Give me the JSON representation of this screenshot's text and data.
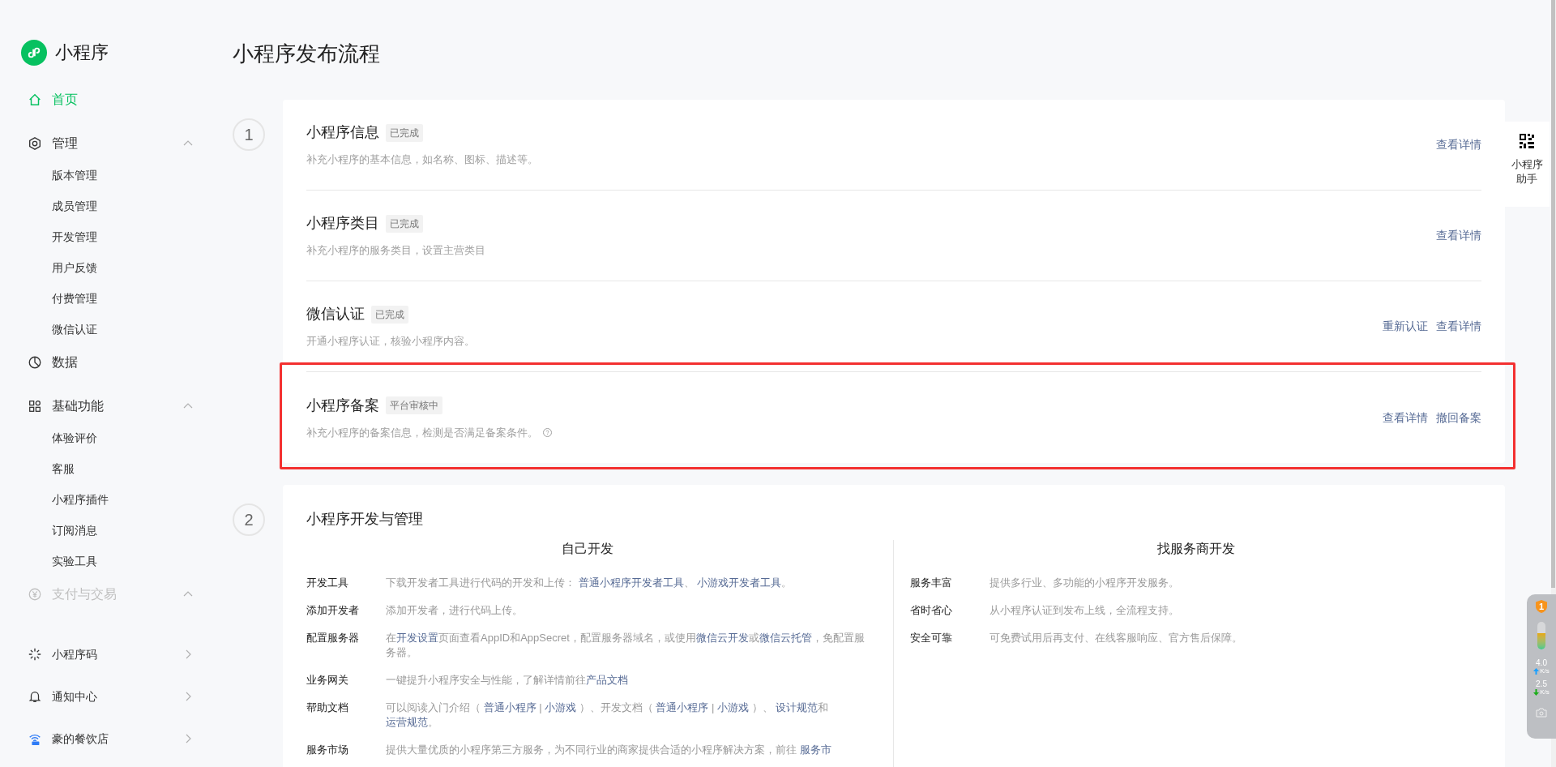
{
  "sidebar": {
    "logo": "小程序",
    "items": [
      {
        "kind": "link",
        "label": "首页",
        "selected": true
      },
      {
        "kind": "group",
        "label": "管理",
        "expanded": true,
        "disabled": false,
        "children": [
          {
            "label": "版本管理"
          },
          {
            "label": "成员管理"
          },
          {
            "label": "开发管理"
          },
          {
            "label": "用户反馈"
          },
          {
            "label": "付费管理"
          },
          {
            "label": "微信认证"
          }
        ]
      },
      {
        "kind": "link",
        "label": "数据",
        "selected": false
      },
      {
        "kind": "group",
        "label": "基础功能",
        "expanded": true,
        "disabled": false,
        "children": [
          {
            "label": "体验评价"
          },
          {
            "label": "客服"
          },
          {
            "label": "小程序插件"
          },
          {
            "label": "订阅消息"
          },
          {
            "label": "实验工具"
          }
        ]
      },
      {
        "kind": "group",
        "label": "支付与交易",
        "expanded": true,
        "disabled": true
      },
      {
        "kind": "nav",
        "label": "小程序码"
      },
      {
        "kind": "nav",
        "label": "通知中心"
      },
      {
        "kind": "nav",
        "label": "豪的餐饮店"
      }
    ]
  },
  "page_title": "小程序发布流程",
  "steps": [
    {
      "kind": "tasks",
      "number": "1",
      "items": [
        {
          "title": "小程序信息",
          "status": "已完成",
          "description": "补充小程序的基本信息，如名称、图标、描述等。",
          "help": false,
          "highlighted": false,
          "actions": [
            "查看详情"
          ]
        },
        {
          "title": "小程序类目",
          "status": "已完成",
          "description": "补充小程序的服务类目，设置主营类目",
          "help": false,
          "highlighted": false,
          "actions": [
            "查看详情"
          ]
        },
        {
          "title": "微信认证",
          "status": "已完成",
          "description": "开通小程序认证，核验小程序内容。",
          "help": false,
          "highlighted": false,
          "actions": [
            "重新认证",
            "查看详情"
          ]
        },
        {
          "title": "小程序备案",
          "status": "平台审核中",
          "description": "补充小程序的备案信息，检测是否满足备案条件。",
          "help": true,
          "highlighted": true,
          "actions": [
            "查看详情",
            "撤回备案"
          ]
        }
      ]
    },
    {
      "kind": "dev",
      "number": "2",
      "title": "小程序开发与管理",
      "columns": [
        {
          "heading": "自己开发",
          "rows": [
            {
              "label": "开发工具",
              "text": [
                {
                  "kind": "text",
                  "text": "下载开发者工具进行代码的开发和上传： "
                },
                {
                  "kind": "link",
                  "text": "普通小程序开发者工具"
                },
                {
                  "kind": "text",
                  "text": "、 "
                },
                {
                  "kind": "link",
                  "text": "小游戏开发者工具"
                },
                {
                  "kind": "text",
                  "text": "。"
                }
              ]
            },
            {
              "label": "添加开发者",
              "text": [
                {
                  "kind": "text",
                  "text": "添加开发者，进行代码上传。"
                }
              ]
            },
            {
              "label": "配置服务器",
              "text": [
                {
                  "kind": "text",
                  "text": "在"
                },
                {
                  "kind": "link",
                  "text": "开发设置"
                },
                {
                  "kind": "text",
                  "text": "页面查看AppID和AppSecret，配置服务器域名，或使用"
                },
                {
                  "kind": "link",
                  "text": "微信云开发"
                },
                {
                  "kind": "text",
                  "text": "或"
                },
                {
                  "kind": "link",
                  "text": "微信云托管"
                },
                {
                  "kind": "text",
                  "text": "，免配置服务器。"
                }
              ]
            },
            {
              "label": "业务网关",
              "text": [
                {
                  "kind": "text",
                  "text": "一键提升小程序安全与性能，了解详情前往"
                },
                {
                  "kind": "link",
                  "text": "产品文档"
                }
              ]
            },
            {
              "label": "帮助文档",
              "text": [
                {
                  "kind": "text",
                  "text": "可以阅读入门介绍（ "
                },
                {
                  "kind": "link",
                  "text": "普通小程序"
                },
                {
                  "kind": "text",
                  "text": " | "
                },
                {
                  "kind": "link",
                  "text": "小游戏"
                },
                {
                  "kind": "text",
                  "text": " ）、开发文档（ "
                },
                {
                  "kind": "link",
                  "text": "普通小程序"
                },
                {
                  "kind": "text",
                  "text": " | "
                },
                {
                  "kind": "link",
                  "text": "小游戏"
                },
                {
                  "kind": "text",
                  "text": " ）、 "
                },
                {
                  "kind": "link",
                  "text": "设计规范"
                },
                {
                  "kind": "text",
                  "text": "和"
                },
                {
                  "kind": "link",
                  "text": "运营规范"
                },
                {
                  "kind": "text",
                  "text": "。"
                }
              ]
            },
            {
              "label": "服务市场",
              "text": [
                {
                  "kind": "text",
                  "text": "提供大量优质的小程序第三方服务，为不同行业的商家提供合适的小程序解决方案，前往 "
                },
                {
                  "kind": "link",
                  "text": "服务市"
                }
              ]
            }
          ]
        },
        {
          "heading": "找服务商开发",
          "rows": [
            {
              "label": "服务丰富",
              "text": [
                {
                  "kind": "text",
                  "text": "提供多行业、多功能的小程序开发服务。"
                }
              ]
            },
            {
              "label": "省时省心",
              "text": [
                {
                  "kind": "text",
                  "text": "从小程序认证到发布上线，全流程支持。"
                }
              ]
            },
            {
              "label": "安全可靠",
              "text": [
                {
                  "kind": "text",
                  "text": "可免费试用后再支付、在线客服响应、官方售后保障。"
                }
              ]
            }
          ]
        }
      ]
    }
  ],
  "assistant": {
    "label": "小程序助手"
  },
  "monitor": {
    "badge": "1",
    "level": 0.6,
    "upload": "4.0",
    "upload_unit": "K/s",
    "download": "2.5",
    "download_unit": "K/s"
  }
}
